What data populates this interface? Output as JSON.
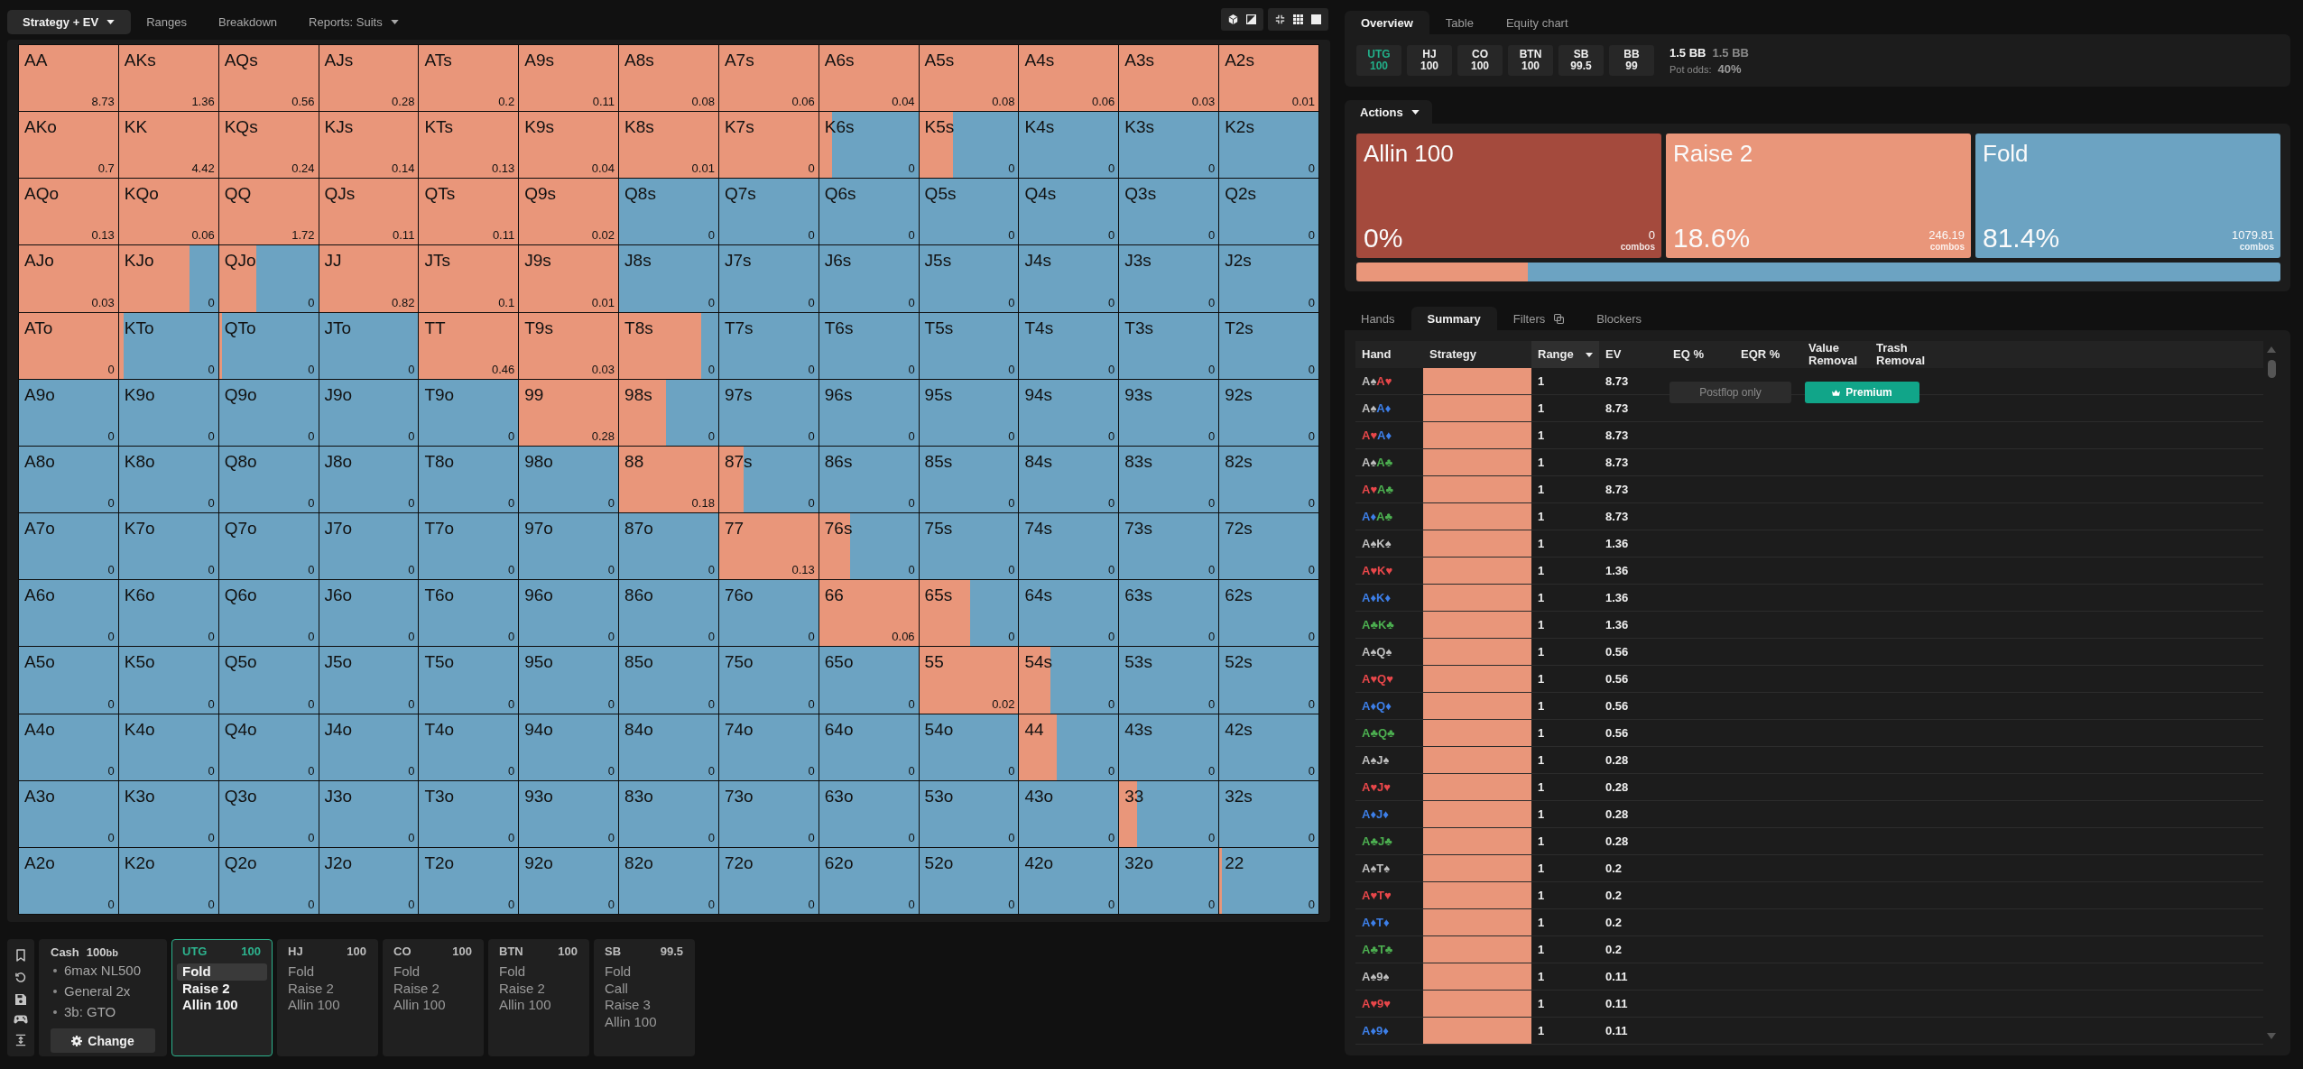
{
  "left_toolbar": {
    "tabs": [
      {
        "label": "Strategy + EV",
        "selected": true,
        "dropdown": true
      },
      {
        "label": "Ranges",
        "selected": false,
        "dropdown": false
      },
      {
        "label": "Breakdown",
        "selected": false,
        "dropdown": false
      },
      {
        "label": "Reports: Suits",
        "selected": false,
        "dropdown": true
      }
    ]
  },
  "hand_matrix": {
    "rows": [
      [
        {
          "hand": "AA",
          "ev": "8.73",
          "level": 1
        },
        {
          "hand": "AKs",
          "ev": "1.36",
          "level": 1
        },
        {
          "hand": "AQs",
          "ev": "0.56",
          "level": 1
        },
        {
          "hand": "AJs",
          "ev": "0.28",
          "level": 1
        },
        {
          "hand": "ATs",
          "ev": "0.2",
          "level": 1
        },
        {
          "hand": "A9s",
          "ev": "0.11",
          "level": 1
        },
        {
          "hand": "A8s",
          "ev": "0.08",
          "level": 1
        },
        {
          "hand": "A7s",
          "ev": "0.06",
          "level": 1
        },
        {
          "hand": "A6s",
          "ev": "0.04",
          "level": 1
        },
        {
          "hand": "A5s",
          "ev": "0.08",
          "level": 1
        },
        {
          "hand": "A4s",
          "ev": "0.06",
          "level": 1
        },
        {
          "hand": "A3s",
          "ev": "0.03",
          "level": 1
        },
        {
          "hand": "A2s",
          "ev": "0.01",
          "level": 1
        }
      ],
      [
        {
          "hand": "AKo",
          "ev": "0.7",
          "level": 1
        },
        {
          "hand": "KK",
          "ev": "4.42",
          "level": 1
        },
        {
          "hand": "KQs",
          "ev": "0.24",
          "level": 1
        },
        {
          "hand": "KJs",
          "ev": "0.14",
          "level": 1
        },
        {
          "hand": "KTs",
          "ev": "0.13",
          "level": 1
        },
        {
          "hand": "K9s",
          "ev": "0.04",
          "level": 1
        },
        {
          "hand": "K8s",
          "ev": "0.01",
          "level": 1
        },
        {
          "hand": "K7s",
          "ev": "0",
          "level": 1
        },
        {
          "hand": "K6s",
          "ev": "0",
          "level": 0.13
        },
        {
          "hand": "K5s",
          "ev": "0",
          "level": 0.34
        },
        {
          "hand": "K4s",
          "ev": "0"
        },
        {
          "hand": "K3s",
          "ev": "0"
        },
        {
          "hand": "K2s",
          "ev": "0"
        }
      ],
      [
        {
          "hand": "AQo",
          "ev": "0.13",
          "level": 1
        },
        {
          "hand": "KQo",
          "ev": "0.06",
          "level": 1
        },
        {
          "hand": "QQ",
          "ev": "1.72",
          "level": 1
        },
        {
          "hand": "QJs",
          "ev": "0.11",
          "level": 1
        },
        {
          "hand": "QTs",
          "ev": "0.11",
          "level": 1
        },
        {
          "hand": "Q9s",
          "ev": "0.02",
          "level": 1
        },
        {
          "hand": "Q8s",
          "ev": "0"
        },
        {
          "hand": "Q7s",
          "ev": "0"
        },
        {
          "hand": "Q6s",
          "ev": "0"
        },
        {
          "hand": "Q5s",
          "ev": "0"
        },
        {
          "hand": "Q4s",
          "ev": "0"
        },
        {
          "hand": "Q3s",
          "ev": "0"
        },
        {
          "hand": "Q2s",
          "ev": "0"
        }
      ],
      [
        {
          "hand": "AJo",
          "ev": "0.03",
          "level": 1
        },
        {
          "hand": "KJo",
          "ev": "0",
          "level": 0.71
        },
        {
          "hand": "QJo",
          "ev": "0",
          "level": 0.38
        },
        {
          "hand": "JJ",
          "ev": "0.82",
          "level": 1
        },
        {
          "hand": "JTs",
          "ev": "0.1",
          "level": 1
        },
        {
          "hand": "J9s",
          "ev": "0.01",
          "level": 1
        },
        {
          "hand": "J8s",
          "ev": "0"
        },
        {
          "hand": "J7s",
          "ev": "0"
        },
        {
          "hand": "J6s",
          "ev": "0"
        },
        {
          "hand": "J5s",
          "ev": "0"
        },
        {
          "hand": "J4s",
          "ev": "0"
        },
        {
          "hand": "J3s",
          "ev": "0"
        },
        {
          "hand": "J2s",
          "ev": "0"
        }
      ],
      [
        {
          "hand": "ATo",
          "ev": "0",
          "level": 1
        },
        {
          "hand": "KTo",
          "ev": "0",
          "level": 0.05
        },
        {
          "hand": "QTo",
          "ev": "0",
          "level": 0.03
        },
        {
          "hand": "JTo",
          "ev": "0"
        },
        {
          "hand": "TT",
          "ev": "0.46",
          "level": 1
        },
        {
          "hand": "T9s",
          "ev": "0.03",
          "level": 1
        },
        {
          "hand": "T8s",
          "ev": "0",
          "level": 0.83
        },
        {
          "hand": "T7s",
          "ev": "0"
        },
        {
          "hand": "T6s",
          "ev": "0"
        },
        {
          "hand": "T5s",
          "ev": "0"
        },
        {
          "hand": "T4s",
          "ev": "0"
        },
        {
          "hand": "T3s",
          "ev": "0"
        },
        {
          "hand": "T2s",
          "ev": "0"
        }
      ],
      [
        {
          "hand": "A9o",
          "ev": "0"
        },
        {
          "hand": "K9o",
          "ev": "0"
        },
        {
          "hand": "Q9o",
          "ev": "0"
        },
        {
          "hand": "J9o",
          "ev": "0"
        },
        {
          "hand": "T9o",
          "ev": "0"
        },
        {
          "hand": "99",
          "ev": "0.28",
          "level": 1
        },
        {
          "hand": "98s",
          "ev": "0",
          "level": 0.47
        },
        {
          "hand": "97s",
          "ev": "0"
        },
        {
          "hand": "96s",
          "ev": "0"
        },
        {
          "hand": "95s",
          "ev": "0"
        },
        {
          "hand": "94s",
          "ev": "0"
        },
        {
          "hand": "93s",
          "ev": "0"
        },
        {
          "hand": "92s",
          "ev": "0"
        }
      ],
      [
        {
          "hand": "A8o",
          "ev": "0"
        },
        {
          "hand": "K8o",
          "ev": "0"
        },
        {
          "hand": "Q8o",
          "ev": "0"
        },
        {
          "hand": "J8o",
          "ev": "0"
        },
        {
          "hand": "T8o",
          "ev": "0"
        },
        {
          "hand": "98o",
          "ev": "0"
        },
        {
          "hand": "88",
          "ev": "0.18",
          "level": 1
        },
        {
          "hand": "87s",
          "ev": "0",
          "level": 0.25
        },
        {
          "hand": "86s",
          "ev": "0"
        },
        {
          "hand": "85s",
          "ev": "0"
        },
        {
          "hand": "84s",
          "ev": "0"
        },
        {
          "hand": "83s",
          "ev": "0"
        },
        {
          "hand": "82s",
          "ev": "0"
        }
      ],
      [
        {
          "hand": "A7o",
          "ev": "0"
        },
        {
          "hand": "K7o",
          "ev": "0"
        },
        {
          "hand": "Q7o",
          "ev": "0"
        },
        {
          "hand": "J7o",
          "ev": "0"
        },
        {
          "hand": "T7o",
          "ev": "0"
        },
        {
          "hand": "97o",
          "ev": "0"
        },
        {
          "hand": "87o",
          "ev": "0"
        },
        {
          "hand": "77",
          "ev": "0.13",
          "level": 1
        },
        {
          "hand": "76s",
          "ev": "0",
          "level": 0.31
        },
        {
          "hand": "75s",
          "ev": "0"
        },
        {
          "hand": "74s",
          "ev": "0"
        },
        {
          "hand": "73s",
          "ev": "0"
        },
        {
          "hand": "72s",
          "ev": "0"
        }
      ],
      [
        {
          "hand": "A6o",
          "ev": "0"
        },
        {
          "hand": "K6o",
          "ev": "0"
        },
        {
          "hand": "Q6o",
          "ev": "0"
        },
        {
          "hand": "J6o",
          "ev": "0"
        },
        {
          "hand": "T6o",
          "ev": "0"
        },
        {
          "hand": "96o",
          "ev": "0"
        },
        {
          "hand": "86o",
          "ev": "0"
        },
        {
          "hand": "76o",
          "ev": "0"
        },
        {
          "hand": "66",
          "ev": "0.06",
          "level": 1
        },
        {
          "hand": "65s",
          "ev": "0",
          "level": 0.51
        },
        {
          "hand": "64s",
          "ev": "0"
        },
        {
          "hand": "63s",
          "ev": "0"
        },
        {
          "hand": "62s",
          "ev": "0"
        }
      ],
      [
        {
          "hand": "A5o",
          "ev": "0"
        },
        {
          "hand": "K5o",
          "ev": "0"
        },
        {
          "hand": "Q5o",
          "ev": "0"
        },
        {
          "hand": "J5o",
          "ev": "0"
        },
        {
          "hand": "T5o",
          "ev": "0"
        },
        {
          "hand": "95o",
          "ev": "0"
        },
        {
          "hand": "85o",
          "ev": "0"
        },
        {
          "hand": "75o",
          "ev": "0"
        },
        {
          "hand": "65o",
          "ev": "0"
        },
        {
          "hand": "55",
          "ev": "0.02",
          "level": 1
        },
        {
          "hand": "54s",
          "ev": "0",
          "level": 0.31
        },
        {
          "hand": "53s",
          "ev": "0"
        },
        {
          "hand": "52s",
          "ev": "0"
        }
      ],
      [
        {
          "hand": "A4o",
          "ev": "0"
        },
        {
          "hand": "K4o",
          "ev": "0"
        },
        {
          "hand": "Q4o",
          "ev": "0"
        },
        {
          "hand": "J4o",
          "ev": "0"
        },
        {
          "hand": "T4o",
          "ev": "0"
        },
        {
          "hand": "94o",
          "ev": "0"
        },
        {
          "hand": "84o",
          "ev": "0"
        },
        {
          "hand": "74o",
          "ev": "0"
        },
        {
          "hand": "64o",
          "ev": "0"
        },
        {
          "hand": "54o",
          "ev": "0"
        },
        {
          "hand": "44",
          "ev": "0",
          "level": 0.38
        },
        {
          "hand": "43s",
          "ev": "0"
        },
        {
          "hand": "42s",
          "ev": "0"
        }
      ],
      [
        {
          "hand": "A3o",
          "ev": "0"
        },
        {
          "hand": "K3o",
          "ev": "0"
        },
        {
          "hand": "Q3o",
          "ev": "0"
        },
        {
          "hand": "J3o",
          "ev": "0"
        },
        {
          "hand": "T3o",
          "ev": "0"
        },
        {
          "hand": "93o",
          "ev": "0"
        },
        {
          "hand": "83o",
          "ev": "0"
        },
        {
          "hand": "73o",
          "ev": "0"
        },
        {
          "hand": "63o",
          "ev": "0"
        },
        {
          "hand": "53o",
          "ev": "0"
        },
        {
          "hand": "43o",
          "ev": "0"
        },
        {
          "hand": "33",
          "ev": "0",
          "level": 0.18
        },
        {
          "hand": "32s",
          "ev": "0"
        }
      ],
      [
        {
          "hand": "A2o",
          "ev": "0"
        },
        {
          "hand": "K2o",
          "ev": "0"
        },
        {
          "hand": "Q2o",
          "ev": "0"
        },
        {
          "hand": "J2o",
          "ev": "0"
        },
        {
          "hand": "T2o",
          "ev": "0"
        },
        {
          "hand": "92o",
          "ev": "0"
        },
        {
          "hand": "82o",
          "ev": "0"
        },
        {
          "hand": "72o",
          "ev": "0"
        },
        {
          "hand": "62o",
          "ev": "0"
        },
        {
          "hand": "52o",
          "ev": "0"
        },
        {
          "hand": "42o",
          "ev": "0"
        },
        {
          "hand": "32o",
          "ev": "0"
        },
        {
          "hand": "22",
          "ev": "0",
          "level": 0.03
        }
      ]
    ]
  },
  "scenario": {
    "game": "Cash",
    "stack": "100",
    "stack_unit": "bb",
    "details": [
      "6max NL500",
      "General 2x",
      "3b: GTO"
    ],
    "button": "Change"
  },
  "positions": [
    {
      "name": "UTG",
      "stack": "100",
      "selected": true,
      "actions": [
        {
          "label": "Fold",
          "selected": true
        },
        {
          "label": "Raise 2",
          "selected": false
        },
        {
          "label": "Allin 100",
          "selected": false
        }
      ]
    },
    {
      "name": "HJ",
      "stack": "100",
      "selected": false,
      "actions": [
        {
          "label": "Fold",
          "selected": false
        },
        {
          "label": "Raise 2",
          "selected": false
        },
        {
          "label": "Allin 100",
          "selected": false
        }
      ]
    },
    {
      "name": "CO",
      "stack": "100",
      "selected": false,
      "actions": [
        {
          "label": "Fold",
          "selected": false
        },
        {
          "label": "Raise 2",
          "selected": false
        },
        {
          "label": "Allin 100",
          "selected": false
        }
      ]
    },
    {
      "name": "BTN",
      "stack": "100",
      "selected": false,
      "actions": [
        {
          "label": "Fold",
          "selected": false
        },
        {
          "label": "Raise 2",
          "selected": false
        },
        {
          "label": "Allin 100",
          "selected": false
        }
      ]
    },
    {
      "name": "SB",
      "stack": "99.5",
      "selected": false,
      "actions": [
        {
          "label": "Fold",
          "selected": false
        },
        {
          "label": "Call",
          "selected": false
        },
        {
          "label": "Raise 3",
          "selected": false
        },
        {
          "label": "Allin 100",
          "selected": false
        }
      ]
    }
  ],
  "right_tabs": [
    {
      "label": "Overview",
      "selected": true
    },
    {
      "label": "Table",
      "selected": false
    },
    {
      "label": "Equity chart",
      "selected": false
    }
  ],
  "overview": {
    "seats": [
      {
        "name": "UTG",
        "stack": "100",
        "selected": true
      },
      {
        "name": "HJ",
        "stack": "100",
        "selected": false
      },
      {
        "name": "CO",
        "stack": "100",
        "selected": false
      },
      {
        "name": "BTN",
        "stack": "100",
        "selected": false
      },
      {
        "name": "SB",
        "stack": "99.5",
        "selected": false
      },
      {
        "name": "BB",
        "stack": "99",
        "selected": false
      }
    ],
    "pot": "1.5 BB",
    "pot_secondary": "1.5 BB",
    "pot_odds_label": "Pot odds:",
    "pot_odds": "40%"
  },
  "actions": {
    "title": "Actions",
    "items": [
      {
        "name": "Allin 100",
        "percent": "0%",
        "combos": "0",
        "combos_label": "combos",
        "color": "#a44a3d"
      },
      {
        "name": "Raise 2",
        "percent": "18.6%",
        "combos": "246.19",
        "combos_label": "combos",
        "color": "#e9967a"
      },
      {
        "name": "Fold",
        "percent": "81.4%",
        "combos": "1079.81",
        "combos_label": "combos",
        "color": "#6ca3c2"
      }
    ],
    "mix_bar": {
      "segments": [
        {
          "color": "#e9967a",
          "level": 0.186
        },
        {
          "color": "#6ca3c2",
          "level": 0.814
        }
      ]
    }
  },
  "summary_tabs": [
    {
      "label": "Hands",
      "selected": false,
      "icon": false
    },
    {
      "label": "Summary",
      "selected": true,
      "icon": false
    },
    {
      "label": "Filters",
      "selected": false,
      "icon": true
    },
    {
      "label": "Blockers",
      "selected": false,
      "icon": false
    }
  ],
  "summary": {
    "columns": [
      {
        "label": "Hand",
        "sorted": false
      },
      {
        "label": "Strategy",
        "sorted": false
      },
      {
        "label": "Range",
        "sorted": true
      },
      {
        "label": "EV",
        "sorted": false
      },
      {
        "label": "EQ %",
        "sorted": false
      },
      {
        "label": "EQR %",
        "sorted": false
      },
      {
        "label": "Value Removal",
        "sorted": false
      },
      {
        "label": "Trash Removal",
        "sorted": false
      }
    ],
    "locked": {
      "postflop": "Postflop only",
      "premium": "Premium"
    },
    "rows": [
      {
        "cards": [
          {
            "text": "A♠",
            "color": "#bfbfbf"
          },
          {
            "text": "A♥",
            "color": "#e8474a"
          }
        ],
        "level": 1,
        "range": "1",
        "ev": "8.73"
      },
      {
        "cards": [
          {
            "text": "A♠",
            "color": "#bfbfbf"
          },
          {
            "text": "A♦",
            "color": "#3d7fe8"
          }
        ],
        "level": 1,
        "range": "1",
        "ev": "8.73"
      },
      {
        "cards": [
          {
            "text": "A♥",
            "color": "#e8474a"
          },
          {
            "text": "A♦",
            "color": "#3d7fe8"
          }
        ],
        "level": 1,
        "range": "1",
        "ev": "8.73"
      },
      {
        "cards": [
          {
            "text": "A♠",
            "color": "#bfbfbf"
          },
          {
            "text": "A♣",
            "color": "#4caf50"
          }
        ],
        "level": 1,
        "range": "1",
        "ev": "8.73"
      },
      {
        "cards": [
          {
            "text": "A♥",
            "color": "#e8474a"
          },
          {
            "text": "A♣",
            "color": "#4caf50"
          }
        ],
        "level": 1,
        "range": "1",
        "ev": "8.73"
      },
      {
        "cards": [
          {
            "text": "A♦",
            "color": "#3d7fe8"
          },
          {
            "text": "A♣",
            "color": "#4caf50"
          }
        ],
        "level": 1,
        "range": "1",
        "ev": "8.73"
      },
      {
        "cards": [
          {
            "text": "A♠",
            "color": "#bfbfbf"
          },
          {
            "text": "K♠",
            "color": "#bfbfbf"
          }
        ],
        "level": 1,
        "range": "1",
        "ev": "1.36"
      },
      {
        "cards": [
          {
            "text": "A♥",
            "color": "#e8474a"
          },
          {
            "text": "K♥",
            "color": "#e8474a"
          }
        ],
        "level": 1,
        "range": "1",
        "ev": "1.36"
      },
      {
        "cards": [
          {
            "text": "A♦",
            "color": "#3d7fe8"
          },
          {
            "text": "K♦",
            "color": "#3d7fe8"
          }
        ],
        "level": 1,
        "range": "1",
        "ev": "1.36"
      },
      {
        "cards": [
          {
            "text": "A♣",
            "color": "#4caf50"
          },
          {
            "text": "K♣",
            "color": "#4caf50"
          }
        ],
        "level": 1,
        "range": "1",
        "ev": "1.36"
      },
      {
        "cards": [
          {
            "text": "A♠",
            "color": "#bfbfbf"
          },
          {
            "text": "Q♠",
            "color": "#bfbfbf"
          }
        ],
        "level": 1,
        "range": "1",
        "ev": "0.56"
      },
      {
        "cards": [
          {
            "text": "A♥",
            "color": "#e8474a"
          },
          {
            "text": "Q♥",
            "color": "#e8474a"
          }
        ],
        "level": 1,
        "range": "1",
        "ev": "0.56"
      },
      {
        "cards": [
          {
            "text": "A♦",
            "color": "#3d7fe8"
          },
          {
            "text": "Q♦",
            "color": "#3d7fe8"
          }
        ],
        "level": 1,
        "range": "1",
        "ev": "0.56"
      },
      {
        "cards": [
          {
            "text": "A♣",
            "color": "#4caf50"
          },
          {
            "text": "Q♣",
            "color": "#4caf50"
          }
        ],
        "level": 1,
        "range": "1",
        "ev": "0.56"
      },
      {
        "cards": [
          {
            "text": "A♠",
            "color": "#bfbfbf"
          },
          {
            "text": "J♠",
            "color": "#bfbfbf"
          }
        ],
        "level": 1,
        "range": "1",
        "ev": "0.28"
      },
      {
        "cards": [
          {
            "text": "A♥",
            "color": "#e8474a"
          },
          {
            "text": "J♥",
            "color": "#e8474a"
          }
        ],
        "level": 1,
        "range": "1",
        "ev": "0.28"
      },
      {
        "cards": [
          {
            "text": "A♦",
            "color": "#3d7fe8"
          },
          {
            "text": "J♦",
            "color": "#3d7fe8"
          }
        ],
        "level": 1,
        "range": "1",
        "ev": "0.28"
      },
      {
        "cards": [
          {
            "text": "A♣",
            "color": "#4caf50"
          },
          {
            "text": "J♣",
            "color": "#4caf50"
          }
        ],
        "level": 1,
        "range": "1",
        "ev": "0.28"
      },
      {
        "cards": [
          {
            "text": "A♠",
            "color": "#bfbfbf"
          },
          {
            "text": "T♠",
            "color": "#bfbfbf"
          }
        ],
        "level": 1,
        "range": "1",
        "ev": "0.2"
      },
      {
        "cards": [
          {
            "text": "A♥",
            "color": "#e8474a"
          },
          {
            "text": "T♥",
            "color": "#e8474a"
          }
        ],
        "level": 1,
        "range": "1",
        "ev": "0.2"
      },
      {
        "cards": [
          {
            "text": "A♦",
            "color": "#3d7fe8"
          },
          {
            "text": "T♦",
            "color": "#3d7fe8"
          }
        ],
        "level": 1,
        "range": "1",
        "ev": "0.2"
      },
      {
        "cards": [
          {
            "text": "A♣",
            "color": "#4caf50"
          },
          {
            "text": "T♣",
            "color": "#4caf50"
          }
        ],
        "level": 1,
        "range": "1",
        "ev": "0.2"
      },
      {
        "cards": [
          {
            "text": "A♠",
            "color": "#bfbfbf"
          },
          {
            "text": "9♠",
            "color": "#bfbfbf"
          }
        ],
        "level": 1,
        "range": "1",
        "ev": "0.11"
      },
      {
        "cards": [
          {
            "text": "A♥",
            "color": "#e8474a"
          },
          {
            "text": "9♥",
            "color": "#e8474a"
          }
        ],
        "level": 1,
        "range": "1",
        "ev": "0.11"
      },
      {
        "cards": [
          {
            "text": "A♦",
            "color": "#3d7fe8"
          },
          {
            "text": "9♦",
            "color": "#3d7fe8"
          }
        ],
        "level": 1,
        "range": "1",
        "ev": "0.11"
      }
    ]
  }
}
